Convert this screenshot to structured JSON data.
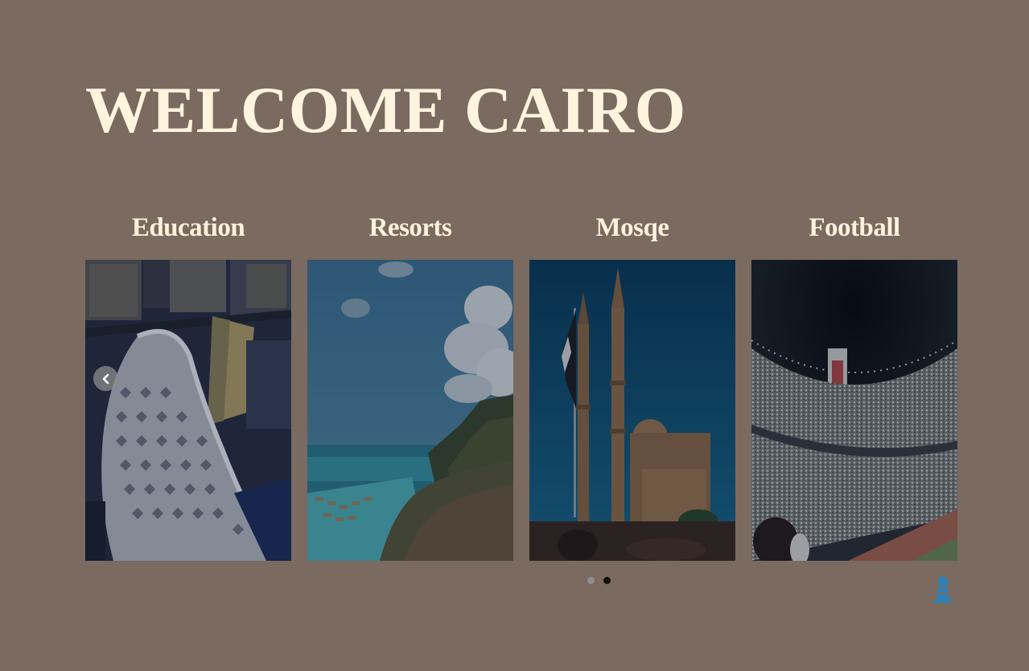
{
  "page": {
    "title": "WELCOME CAIRO",
    "background_color": "#7a6a5f",
    "text_color": "#fff4dd"
  },
  "carousel": {
    "cards": [
      {
        "label": "Education",
        "image": "library-building-aerial-photo"
      },
      {
        "label": "Resorts",
        "image": "beach-resort-coast-photo"
      },
      {
        "label": "Mosqe",
        "image": "mosque-minarets-photo"
      },
      {
        "label": "Football",
        "image": "stadium-crowd-photo"
      }
    ],
    "prev_icon": "chevron-left-icon",
    "pagination": {
      "count": 2,
      "active_index": 1
    }
  },
  "scroll_top": {
    "icon": "lighthouse-icon",
    "color": "#2b82b8"
  }
}
